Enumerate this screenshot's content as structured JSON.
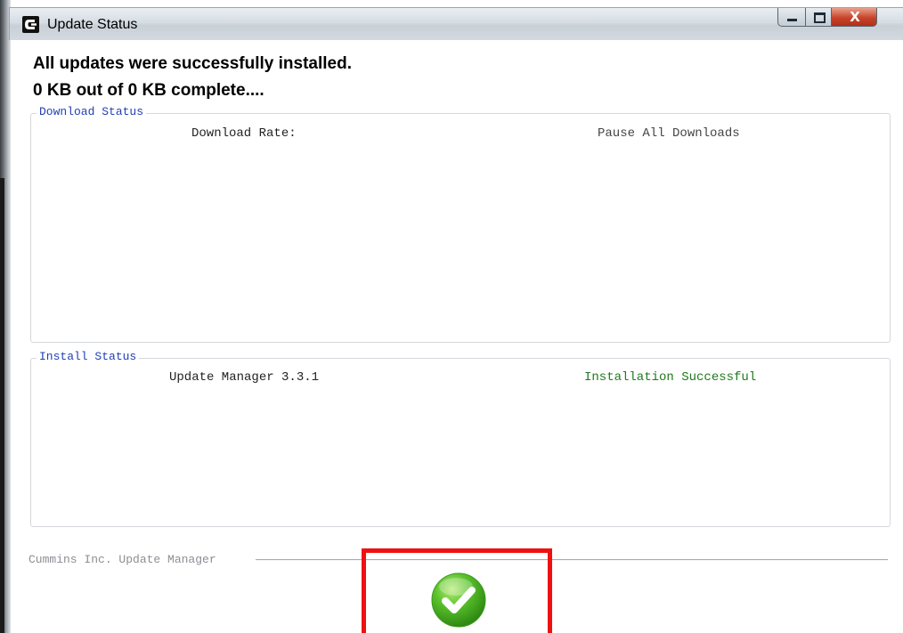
{
  "window": {
    "title": "Update Status",
    "controls": {
      "minimize_icon": "minimize-icon",
      "maximize_icon": "maximize-icon",
      "close_glyph": "X"
    }
  },
  "status": {
    "headline": "All updates were successfully installed.",
    "progress": "0 KB out of 0 KB complete...."
  },
  "download_status": {
    "legend": "Download Status",
    "rate_label": "Download Rate:",
    "pause_label": "Pause All Downloads"
  },
  "install_status": {
    "legend": "Install Status",
    "items": [
      {
        "name": "Update Manager 3.3.1",
        "status": "Installation Successful"
      }
    ]
  },
  "footer": {
    "label": "Cummins Inc. Update Manager",
    "ok_icon": "checkmark-icon"
  },
  "colors": {
    "legend_blue": "#1f3fb5",
    "success_green": "#1d7a1d",
    "highlight_red": "#ee1111",
    "check_green": "#4fb52a"
  }
}
